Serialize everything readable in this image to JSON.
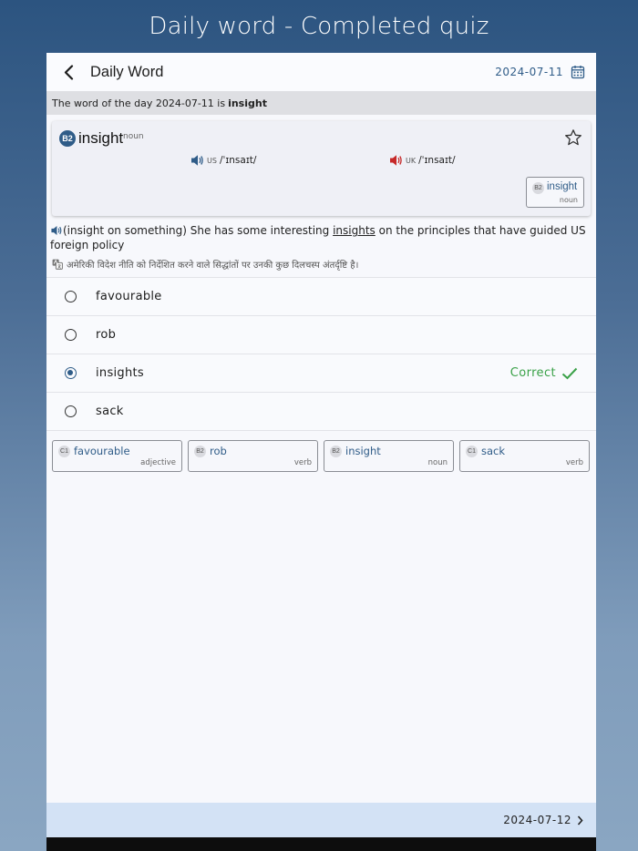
{
  "banner": {
    "title": "Daily word - Completed quiz"
  },
  "header": {
    "title": "Daily Word",
    "date": "2024-07-11"
  },
  "wod_strip": {
    "prefix": "The word of the day 2024-07-11 is",
    "word": "insight"
  },
  "word_card": {
    "level": "B2",
    "word": "insight",
    "pos": "noun",
    "us": {
      "label": "US",
      "ipa": "/ˈɪnsaɪt/"
    },
    "uk": {
      "label": "UK",
      "ipa": "/ˈɪnsaɪt/"
    },
    "chip": {
      "level": "B2",
      "word": "insight",
      "pos": "noun"
    }
  },
  "example": {
    "before": "(insight on something) She has some interesting",
    "highlight": "insights",
    "after": "on the principles that have guided US foreign policy",
    "translation": "अमेरिकी विदेश नीति को निर्देशित करने वाले सिद्धांतों पर उनकी कुछ दिलचस्प अंतर्दृष्टि है।"
  },
  "quiz": {
    "options": [
      {
        "label": "favourable",
        "selected": false
      },
      {
        "label": "rob",
        "selected": false
      },
      {
        "label": "insights",
        "selected": true
      },
      {
        "label": "sack",
        "selected": false
      }
    ],
    "result_label": "Correct",
    "result_color": "#3aa148"
  },
  "word_chips": [
    {
      "level": "C1",
      "word": "favourable",
      "pos": "adjective"
    },
    {
      "level": "B2",
      "word": "rob",
      "pos": "verb"
    },
    {
      "level": "B2",
      "word": "insight",
      "pos": "noun"
    },
    {
      "level": "C1",
      "word": "sack",
      "pos": "verb"
    }
  ],
  "footer": {
    "next_date": "2024-07-12"
  },
  "colors": {
    "accent": "#2f5c88",
    "uk_speaker": "#c62828",
    "bottom_bar": "#d3e2f5"
  }
}
